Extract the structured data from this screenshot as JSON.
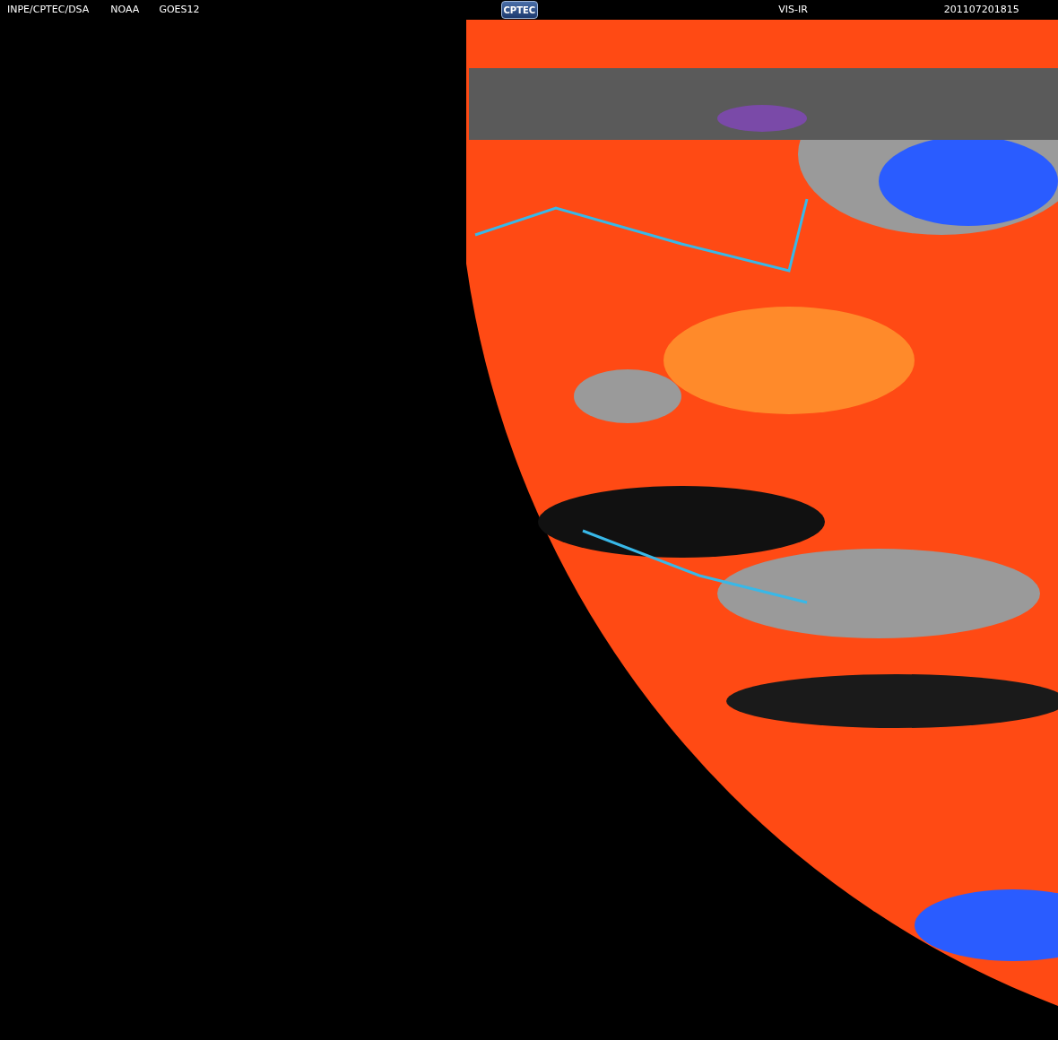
{
  "header": {
    "agency": "INPE/CPTEC/DSA",
    "provider": "NOAA",
    "satellite": "GOES12",
    "logo": "CPTEC",
    "channel": "VIS-IR",
    "timestamp": "201107201815"
  }
}
